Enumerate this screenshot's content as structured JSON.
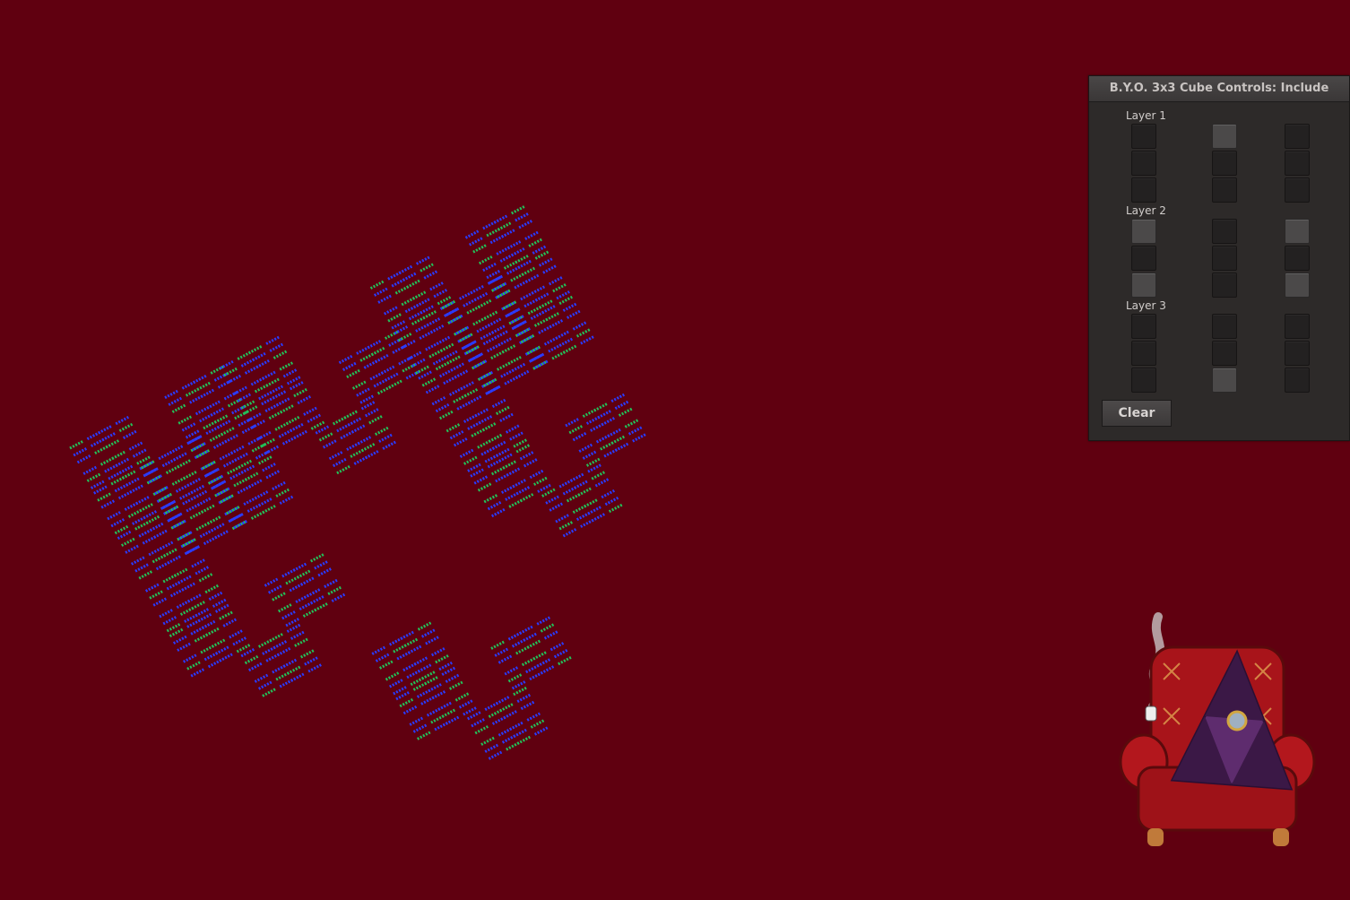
{
  "panel": {
    "title": "B.Y.O. 3x3 Cube Controls: Include",
    "clear_label": "Clear",
    "layers": [
      {
        "label": "Layer 1",
        "cells": [
          [
            false,
            true,
            false
          ],
          [
            false,
            false,
            false
          ],
          [
            false,
            false,
            false
          ]
        ]
      },
      {
        "label": "Layer 2",
        "cells": [
          [
            true,
            false,
            true
          ],
          [
            false,
            false,
            false
          ],
          [
            true,
            false,
            true
          ]
        ]
      },
      {
        "label": "Layer 3",
        "cells": [
          [
            false,
            false,
            false
          ],
          [
            false,
            false,
            false
          ],
          [
            false,
            true,
            false
          ]
        ]
      }
    ]
  },
  "colors": {
    "background": "#600010",
    "panel": "#2d2a29",
    "cell_off": "#232121",
    "cell_on": "#4b4949",
    "pattern_blue": "#2a3cff",
    "pattern_green": "#22c25a"
  },
  "mascot": {
    "name": "triangle-in-armchair-mascot"
  }
}
